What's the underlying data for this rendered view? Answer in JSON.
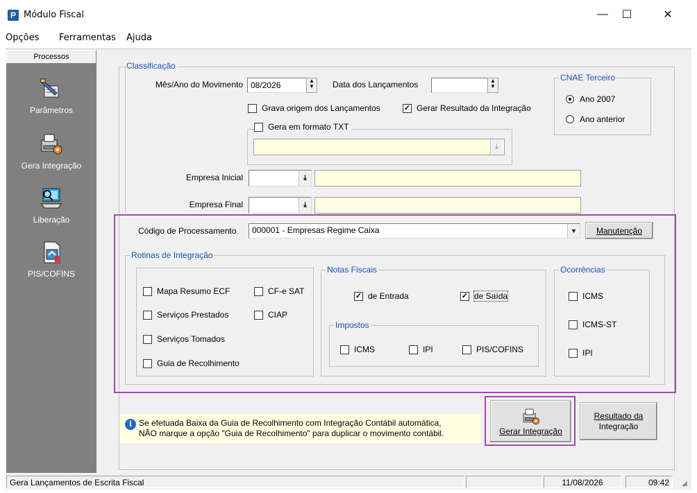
{
  "window": {
    "title": "Módulo Fiscal",
    "icon_letter": "P",
    "minimize": "—",
    "maximize": "☐",
    "close": "✕"
  },
  "menu": [
    "Opções",
    "Ferramentas",
    "Ajuda"
  ],
  "sidebar": {
    "header": "Processos",
    "items": [
      {
        "label": "Parâmetros",
        "icon": "parameters-icon"
      },
      {
        "label": "Gera Integração",
        "icon": "generate-integration-icon"
      },
      {
        "label": "Liberação",
        "icon": "release-icon"
      },
      {
        "label": "PIS/COFINS",
        "icon": "pis-cofins-icon"
      }
    ]
  },
  "classificacao": {
    "title": "Classificação",
    "mes_ano_label": "Mês/Ano do Movimento",
    "mes_ano_value": "08/2026",
    "data_lanc_label": "Data dos Lançamentos",
    "data_lanc_value": "",
    "grava_origem": {
      "label": "Grava origem dos Lançamentos",
      "checked": false
    },
    "gerar_resultado": {
      "label": "Gerar Resultado da Integração",
      "checked": true
    },
    "gera_txt": {
      "label": "Gera em formato TXT",
      "checked": false
    },
    "txt_path": "",
    "empresa_inicial_label": "Empresa Inicial",
    "empresa_final_label": "Empresa Final"
  },
  "cnae": {
    "title": "CNAE Terceiro",
    "options": [
      {
        "label": "Ano 2007",
        "selected": true
      },
      {
        "label": "Ano anterior",
        "selected": false
      }
    ]
  },
  "codigo": {
    "label": "Código de Processamento",
    "value": "000001 - Empresas Regime Caixa",
    "button": "Manutenção"
  },
  "rotinas": {
    "title": "Rotinas de Integração",
    "items": [
      {
        "label": "Mapa Resumo ECF",
        "checked": false
      },
      {
        "label": "Serviços Prestados",
        "checked": false
      },
      {
        "label": "Serviços Tomados",
        "checked": false
      },
      {
        "label": "Guia de Recolhimento",
        "checked": false
      },
      {
        "label": "CF-e SAT",
        "checked": false
      },
      {
        "label": "CIAP",
        "checked": false
      }
    ],
    "notas": {
      "title": "Notas Fiscais",
      "entrada": {
        "label": "de Entrada",
        "checked": true
      },
      "saida": {
        "label": "de Saída",
        "checked": true
      }
    },
    "impostos": {
      "title": "Impostos",
      "items": [
        {
          "label": "ICMS",
          "checked": false
        },
        {
          "label": "IPI",
          "checked": false
        },
        {
          "label": "PIS/COFINS",
          "checked": false
        }
      ]
    },
    "ocorrencias": {
      "title": "Ocorrências",
      "items": [
        {
          "label": "ICMS",
          "checked": false
        },
        {
          "label": "ICMS-ST",
          "checked": false
        },
        {
          "label": "IPI",
          "checked": false
        }
      ]
    }
  },
  "info": {
    "line1": "Se efetuada Baixa da Guia de Recolhimento com Integração Contábil automática,",
    "line2": "NÃO marque a opção \"Guia de Recolhimento\" para duplicar o movimento contábil."
  },
  "buttons": {
    "gerar": "Gerar Integração",
    "resultado_line1": "Resultado da",
    "resultado_line2": "Integração"
  },
  "status": {
    "text": "Gera Lançamentos de Escrita Fiscal",
    "date": "11/08/2026",
    "time": "09:42"
  },
  "colors": {
    "highlight": "#a04ab0",
    "group_title": "#1e50c8",
    "sidebar_bg": "#808080",
    "yellow_field": "#ffffe1"
  }
}
